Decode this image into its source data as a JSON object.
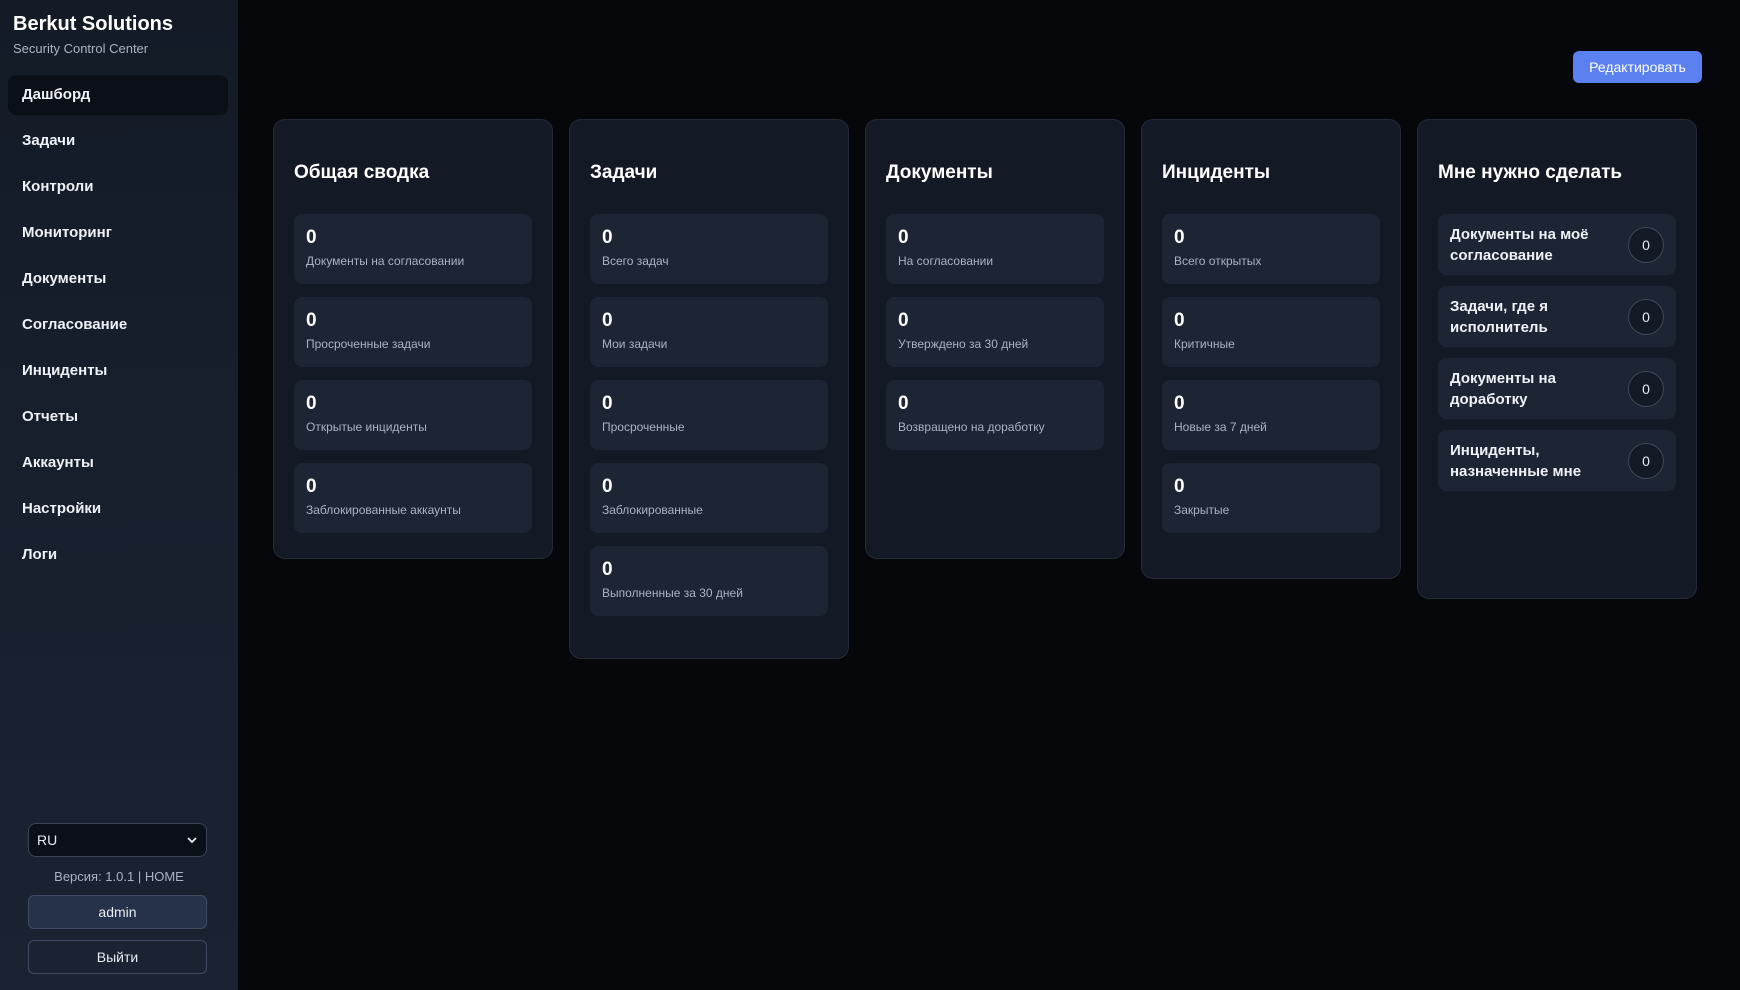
{
  "brand": {
    "title": "Berkut Solutions",
    "subtitle": "Security Control Center"
  },
  "nav": [
    {
      "label": "Дашборд",
      "active": true
    },
    {
      "label": "Задачи"
    },
    {
      "label": "Контроли"
    },
    {
      "label": "Мониторинг"
    },
    {
      "label": "Документы"
    },
    {
      "label": "Согласование"
    },
    {
      "label": "Инциденты"
    },
    {
      "label": "Отчеты"
    },
    {
      "label": "Аккаунты"
    },
    {
      "label": "Настройки"
    },
    {
      "label": "Логи"
    }
  ],
  "footer": {
    "language": "RU",
    "version": "Версия: 1.0.1 | HOME",
    "user": "admin",
    "logout": "Выйти"
  },
  "header": {
    "edit_label": "Редактировать"
  },
  "cards": {
    "summary": {
      "title": "Общая сводка",
      "stats": [
        {
          "value": "0",
          "label": "Документы на согласовании"
        },
        {
          "value": "0",
          "label": "Просроченные задачи"
        },
        {
          "value": "0",
          "label": "Открытые инциденты"
        },
        {
          "value": "0",
          "label": "Заблокированные аккаунты"
        }
      ]
    },
    "tasks": {
      "title": "Задачи",
      "stats": [
        {
          "value": "0",
          "label": "Всего задач"
        },
        {
          "value": "0",
          "label": "Мои задачи"
        },
        {
          "value": "0",
          "label": "Просроченные"
        },
        {
          "value": "0",
          "label": "Заблокированные"
        },
        {
          "value": "0",
          "label": "Выполненные за 30 дней"
        }
      ]
    },
    "documents": {
      "title": "Документы",
      "stats": [
        {
          "value": "0",
          "label": "На согласовании"
        },
        {
          "value": "0",
          "label": "Утверждено за 30 дней"
        },
        {
          "value": "0",
          "label": "Возвращено на доработку"
        }
      ]
    },
    "incidents": {
      "title": "Инциденты",
      "stats": [
        {
          "value": "0",
          "label": "Всего открытых"
        },
        {
          "value": "0",
          "label": "Критичные"
        },
        {
          "value": "0",
          "label": "Новые за 7 дней"
        },
        {
          "value": "0",
          "label": "Закрытые"
        }
      ]
    },
    "todo": {
      "title": "Мне нужно сделать",
      "items": [
        {
          "label": "Документы на моё согласование",
          "count": "0"
        },
        {
          "label": "Задачи, где я исполнитель",
          "count": "0"
        },
        {
          "label": "Документы на доработку",
          "count": "0"
        },
        {
          "label": "Инциденты, назначенные мне",
          "count": "0"
        }
      ]
    }
  },
  "colors": {
    "accent": "#5b80f0",
    "background": "#05070b",
    "card": "#131925",
    "stat": "#1d2433"
  }
}
